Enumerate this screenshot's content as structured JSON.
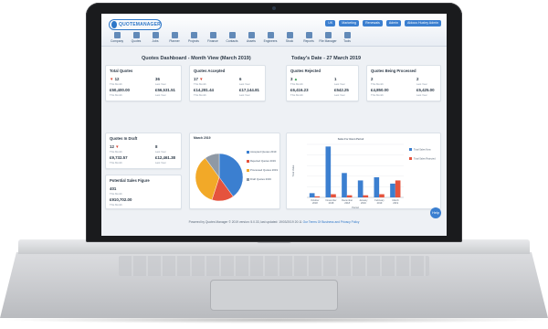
{
  "app": {
    "logo_text": "QUOTEMANAGER",
    "top_buttons": [
      "UK",
      "Marketing",
      "Renewals",
      "Admin",
      "Aldous Huxley Admin"
    ],
    "nav": [
      "Company",
      "Quotes",
      "Jobs",
      "Planner",
      "Projects",
      "Finance",
      "Contacts",
      "Assets",
      "Engineers",
      "Stock",
      "Reports",
      "File Manager",
      "Tools"
    ]
  },
  "dashboard": {
    "title": "Quotes Dashboard - Month View (March 2019)",
    "today": "Today's Date - 27 March 2019"
  },
  "cards": {
    "total": {
      "title": "Total Quotes",
      "count": "12",
      "count_sub": "This Month",
      "count_right": "36",
      "count_right_sub": "Last Year",
      "value": "£50,400.00",
      "value_sub": "This Month",
      "value_right": "£56,531.51",
      "value_right_sub": "Last Year"
    },
    "accepted": {
      "title": "Quotes Accepted",
      "count": "17",
      "count_sub": "This Month",
      "count_right": "6",
      "count_right_sub": "Last Year",
      "value": "£14,281.44",
      "value_sub": "This Month",
      "value_right": "£17,144.81",
      "value_right_sub": "Last Year"
    },
    "rejected": {
      "title": "Quotes Rejected",
      "count": "3",
      "count_sub": "This Month",
      "count_right": "1",
      "count_right_sub": "Last Year",
      "value": "£6,416.23",
      "value_sub": "This Month",
      "value_right": "£542.25",
      "value_right_sub": "Last Year"
    },
    "processed": {
      "title": "Quotes Being Processed",
      "count": "2",
      "count_sub": "This Month",
      "count_right": "2",
      "count_right_sub": "Last Year",
      "value": "£4,850.00",
      "value_sub": "This Month",
      "value_right": "£5,425.00",
      "value_right_sub": "Last Year"
    },
    "draft": {
      "title": "Quotes In Draft",
      "count": "12",
      "count_sub": "This Month",
      "count_right": "8",
      "count_right_sub": "Last Year",
      "value": "£9,732.57",
      "value_sub": "This Month",
      "value_right": "£12,461.38",
      "value_right_sub": "Last Year"
    },
    "potential": {
      "title": "Potential Sales Figure",
      "count": "401",
      "count_sub": "This Month",
      "value": "£910,702.00",
      "value_sub": "This Month"
    }
  },
  "footer": {
    "text": "Powered by Quotes Manager © 2019 version: 5.0.33, last updated: 19/03/2019 20:11",
    "link": "Our Terms Of Business and Privacy Policy"
  },
  "help_label": "Help",
  "colors": {
    "blue": "#3b7fd0",
    "orange": "#e5533d",
    "yellow": "#f2a928",
    "grey": "#8f99a5",
    "green": "#2c9a4a"
  },
  "chart_data": [
    {
      "type": "pie",
      "title": "March 2019",
      "labels": [
        "Accepted Quotes 2019",
        "Rejected Quotes 2019",
        "Processed Quotes 2019",
        "Draft Quotes 2019"
      ],
      "values": [
        40,
        15,
        35,
        10
      ]
    },
    {
      "type": "bar",
      "title": "Sales For Given Period",
      "xlabel": "Period",
      "ylabel": "Total Value",
      "categories": [
        "October 2018",
        "November 2018",
        "December 2018",
        "January 2019",
        "February 2019",
        "March 2019"
      ],
      "series": [
        {
          "name": "Total Sales Now",
          "values": [
            0.4,
            4.8,
            2.3,
            1.6,
            1.9,
            1.3
          ]
        },
        {
          "name": "Total Sales Rejected",
          "values": [
            0.1,
            0.3,
            0.2,
            0.2,
            0.3,
            1.6
          ]
        }
      ],
      "ylim": [
        0,
        5
      ],
      "grid": true,
      "legend": "top-right"
    }
  ]
}
